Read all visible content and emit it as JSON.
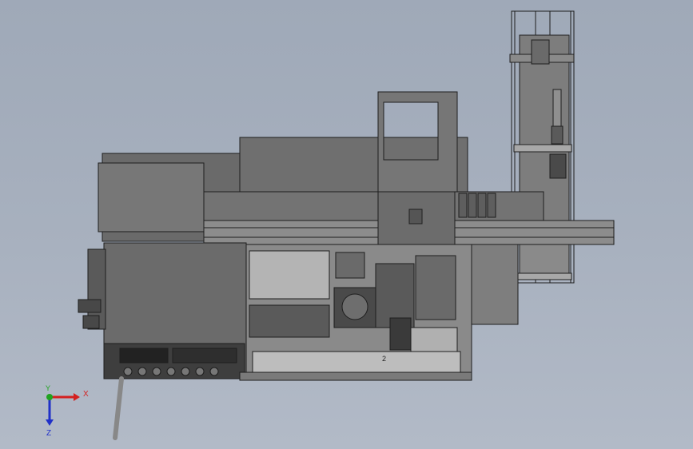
{
  "viewport": {
    "background_top": "#9fa9b8",
    "background_bottom": "#b2bac7"
  },
  "model": {
    "body_color": "#6f6f6f",
    "dark_color": "#3c3c3c",
    "light_color": "#bdbdbd",
    "part_label": "2"
  },
  "triad": {
    "x_label": "X",
    "y_label": "Y",
    "z_label": "Z",
    "x_color": "#d42020",
    "y_color": "#1fa31f",
    "z_color": "#2030c8"
  }
}
